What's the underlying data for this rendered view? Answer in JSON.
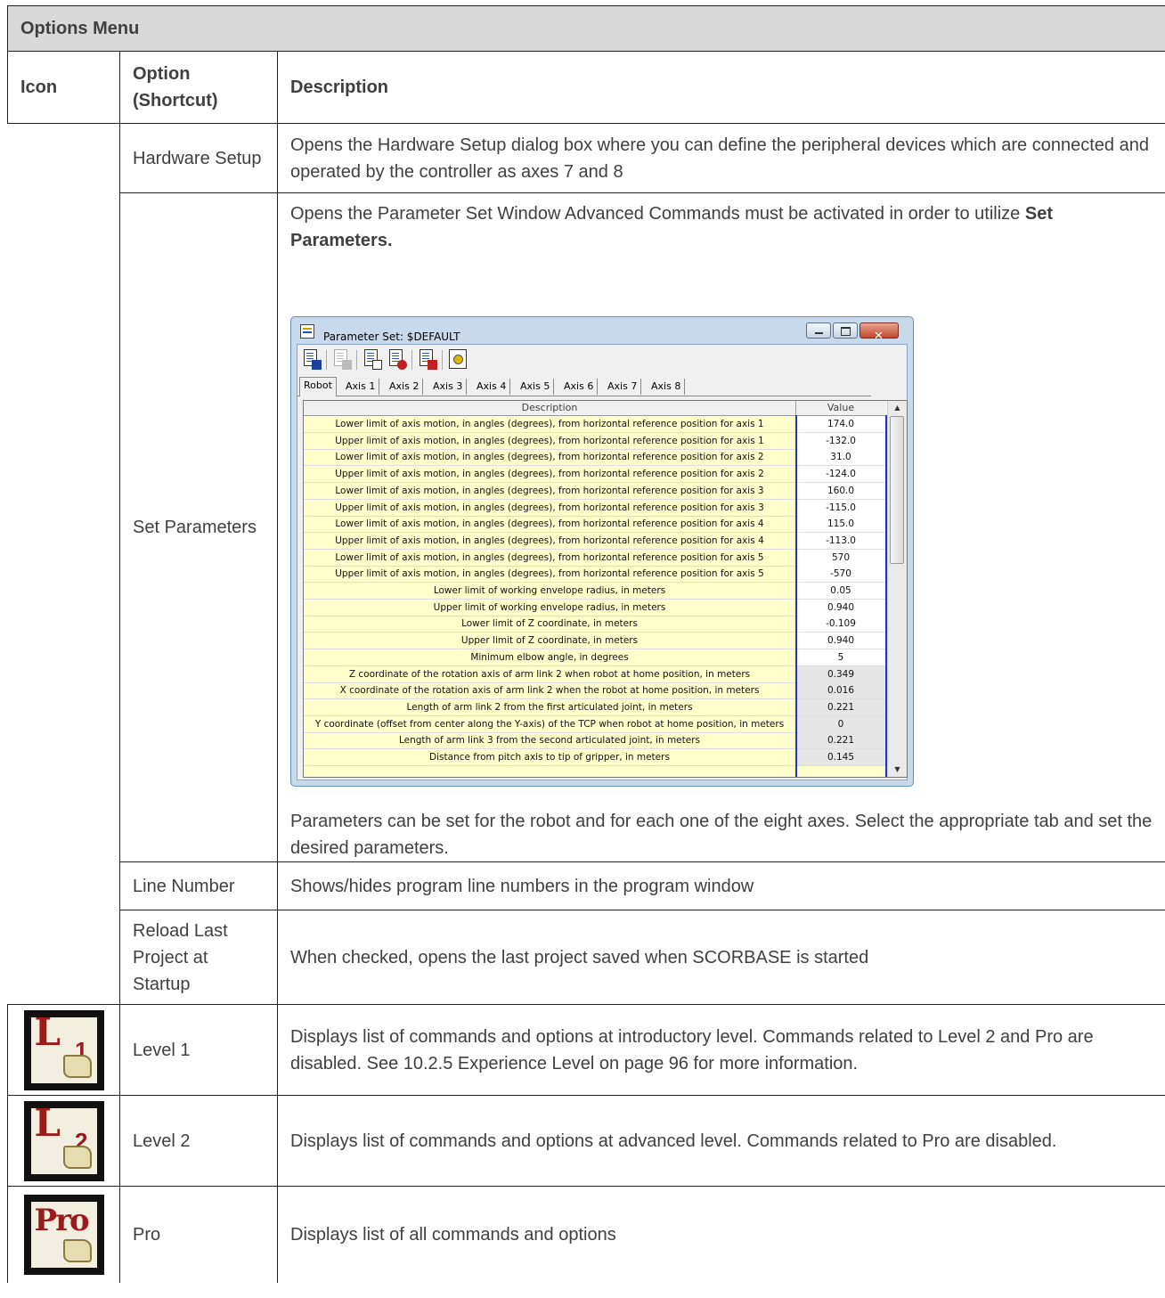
{
  "table": {
    "title": "Options Menu",
    "headers": {
      "icon": "Icon",
      "option": "Option (Shortcut)",
      "description": "Description"
    },
    "rows": [
      {
        "option": "Hardware Setup",
        "description": "Opens the Hardware Setup dialog box where you can define the peripheral devices which are connected and operated by the controller as axes 7 and 8"
      },
      {
        "option": "Set Parameters",
        "description_pre": "Opens the Parameter Set Window Advanced Commands must be activated in order to utilize ",
        "description_bold": "Set Parameters.",
        "description_post": "Parameters can be set for the robot and for each one of the eight axes. Select the appropriate tab and set the desired parameters."
      },
      {
        "option": "Line Number",
        "description": "Shows/hides program line numbers in the program window"
      },
      {
        "option": "Reload Last Project at Startup",
        "description": "When checked, opens the last project saved when SCORBASE is started"
      },
      {
        "option": "Level 1",
        "icon": "level-1-icon",
        "icon_text": "L",
        "icon_sub": "1",
        "description": "Displays list of commands and options at introductory level. Commands related to Level 2 and Pro are disabled. See 10.2.5 Experience Level on page 96 for more information."
      },
      {
        "option": "Level 2",
        "icon": "level-2-icon",
        "icon_text": "L",
        "icon_sub": "2",
        "description": "Displays list of commands and options at advanced level. Commands related to Pro are disabled."
      },
      {
        "option": "Pro",
        "icon": "pro-icon",
        "icon_text": "Pro",
        "description": "Displays list of all commands and options"
      }
    ]
  },
  "window": {
    "title": "Parameter Set:   $DEFAULT",
    "tabs": [
      "Robot",
      "Axis 1",
      "Axis 2",
      "Axis 3",
      "Axis 4",
      "Axis 5",
      "Axis 6",
      "Axis 7",
      "Axis 8"
    ],
    "active_tab": "Robot",
    "columns": [
      "Description",
      "Value"
    ],
    "params": [
      {
        "d": "Lower limit of axis motion, in angles (degrees), from horizontal reference position for axis  1",
        "v": "174.0"
      },
      {
        "d": "Upper limit of axis motion, in angles (degrees), from horizontal reference position for axis  1",
        "v": "-132.0"
      },
      {
        "d": "Lower limit of axis motion, in angles (degrees), from horizontal reference position for axis  2",
        "v": "31.0"
      },
      {
        "d": "Upper limit of axis motion, in angles (degrees), from horizontal reference position for axis  2",
        "v": "-124.0"
      },
      {
        "d": "Lower limit of axis motion, in angles (degrees), from horizontal reference position for axis  3",
        "v": "160.0"
      },
      {
        "d": "Upper limit of axis motion, in angles (degrees), from horizontal reference position for axis  3",
        "v": "-115.0"
      },
      {
        "d": "Lower limit of axis motion, in angles (degrees), from horizontal reference position for axis  4",
        "v": "115.0"
      },
      {
        "d": "Upper limit of axis motion, in angles (degrees), from horizontal reference position for axis 4",
        "v": "-113.0"
      },
      {
        "d": "Lower limit of axis motion, in angles (degrees), from horizontal reference position for axis  5",
        "v": "570"
      },
      {
        "d": "Upper limit of axis motion, in angles (degrees), from horizontal reference position for axis 5",
        "v": "-570"
      },
      {
        "d": "Lower limit of working envelope radius, in meters",
        "v": "0.05"
      },
      {
        "d": "Upper limit of working envelope radius, in meters",
        "v": "0.940"
      },
      {
        "d": "Lower limit of Z coordinate, in meters",
        "v": "-0.109"
      },
      {
        "d": "Upper limit of Z coordinate, in meters",
        "v": "0.940"
      },
      {
        "d": "Minimum elbow angle, in degrees",
        "v": "5"
      },
      {
        "d": "Z coordinate of the rotation axis of arm link 2 when robot at home position, in meters",
        "v": "0.349",
        "gray": true
      },
      {
        "d": "X coordinate of the rotation axis of arm link 2 when the robot at home position, in meters",
        "v": "0.016",
        "gray": true
      },
      {
        "d": "Length of arm link 2 from the first articulated joint, in meters",
        "v": "0.221",
        "gray": true
      },
      {
        "d": "Y coordinate (offset from center along the Y-axis) of the TCP when robot at home position, in meters",
        "v": "0",
        "gray": true
      },
      {
        "d": "Length of arm link 3 from the second articulated joint, in meters",
        "v": "0.221",
        "gray": true
      },
      {
        "d": "Distance from pitch axis to tip of gripper, in meters",
        "v": "0.145",
        "gray": true
      }
    ]
  }
}
